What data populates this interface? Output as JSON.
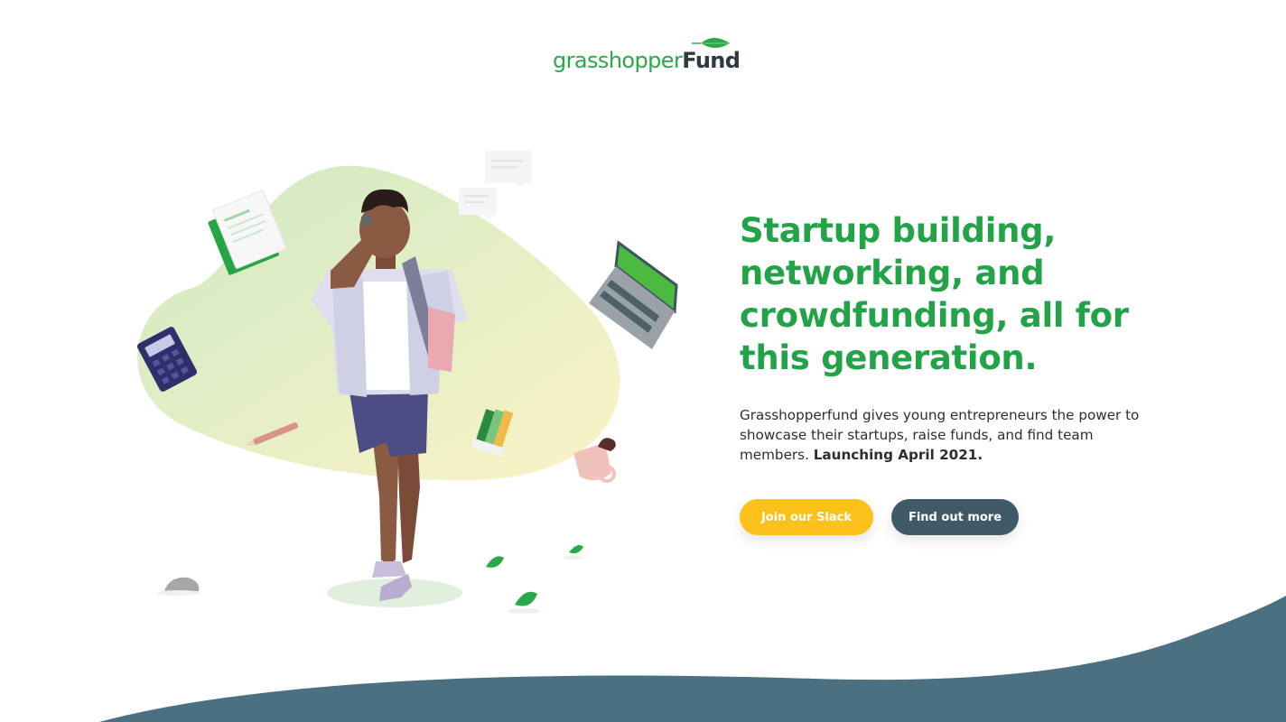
{
  "brand": {
    "name_light": "grasshopper",
    "name_bold": "Fund",
    "green": "#2aa84a",
    "dark": "#2e3a3f",
    "icon": "leaf-icon"
  },
  "hero": {
    "title": "Startup building, networking, and crowdfunding, all for this generation.",
    "description": "Grasshopperfund gives young entrepreneurs the power to showcase their startups, raise funds, and find team members.",
    "description_bold": "Launching April 2021.",
    "title_color": "#22a347"
  },
  "buttons": {
    "slack_label": "Join our Slack",
    "more_label": "Find out more",
    "slack_color": "#fcc21b",
    "more_color": "#405a68"
  },
  "illustration": {
    "subject": "person-on-phone",
    "icons": [
      "document-icon",
      "calculator-icon",
      "laptop-icon",
      "chat-bubble-icon",
      "pencil-icon",
      "color-swatch-icon",
      "mug-icon",
      "leaf-icon",
      "stone-icon"
    ]
  },
  "footer_wave_color": "#4a7081"
}
